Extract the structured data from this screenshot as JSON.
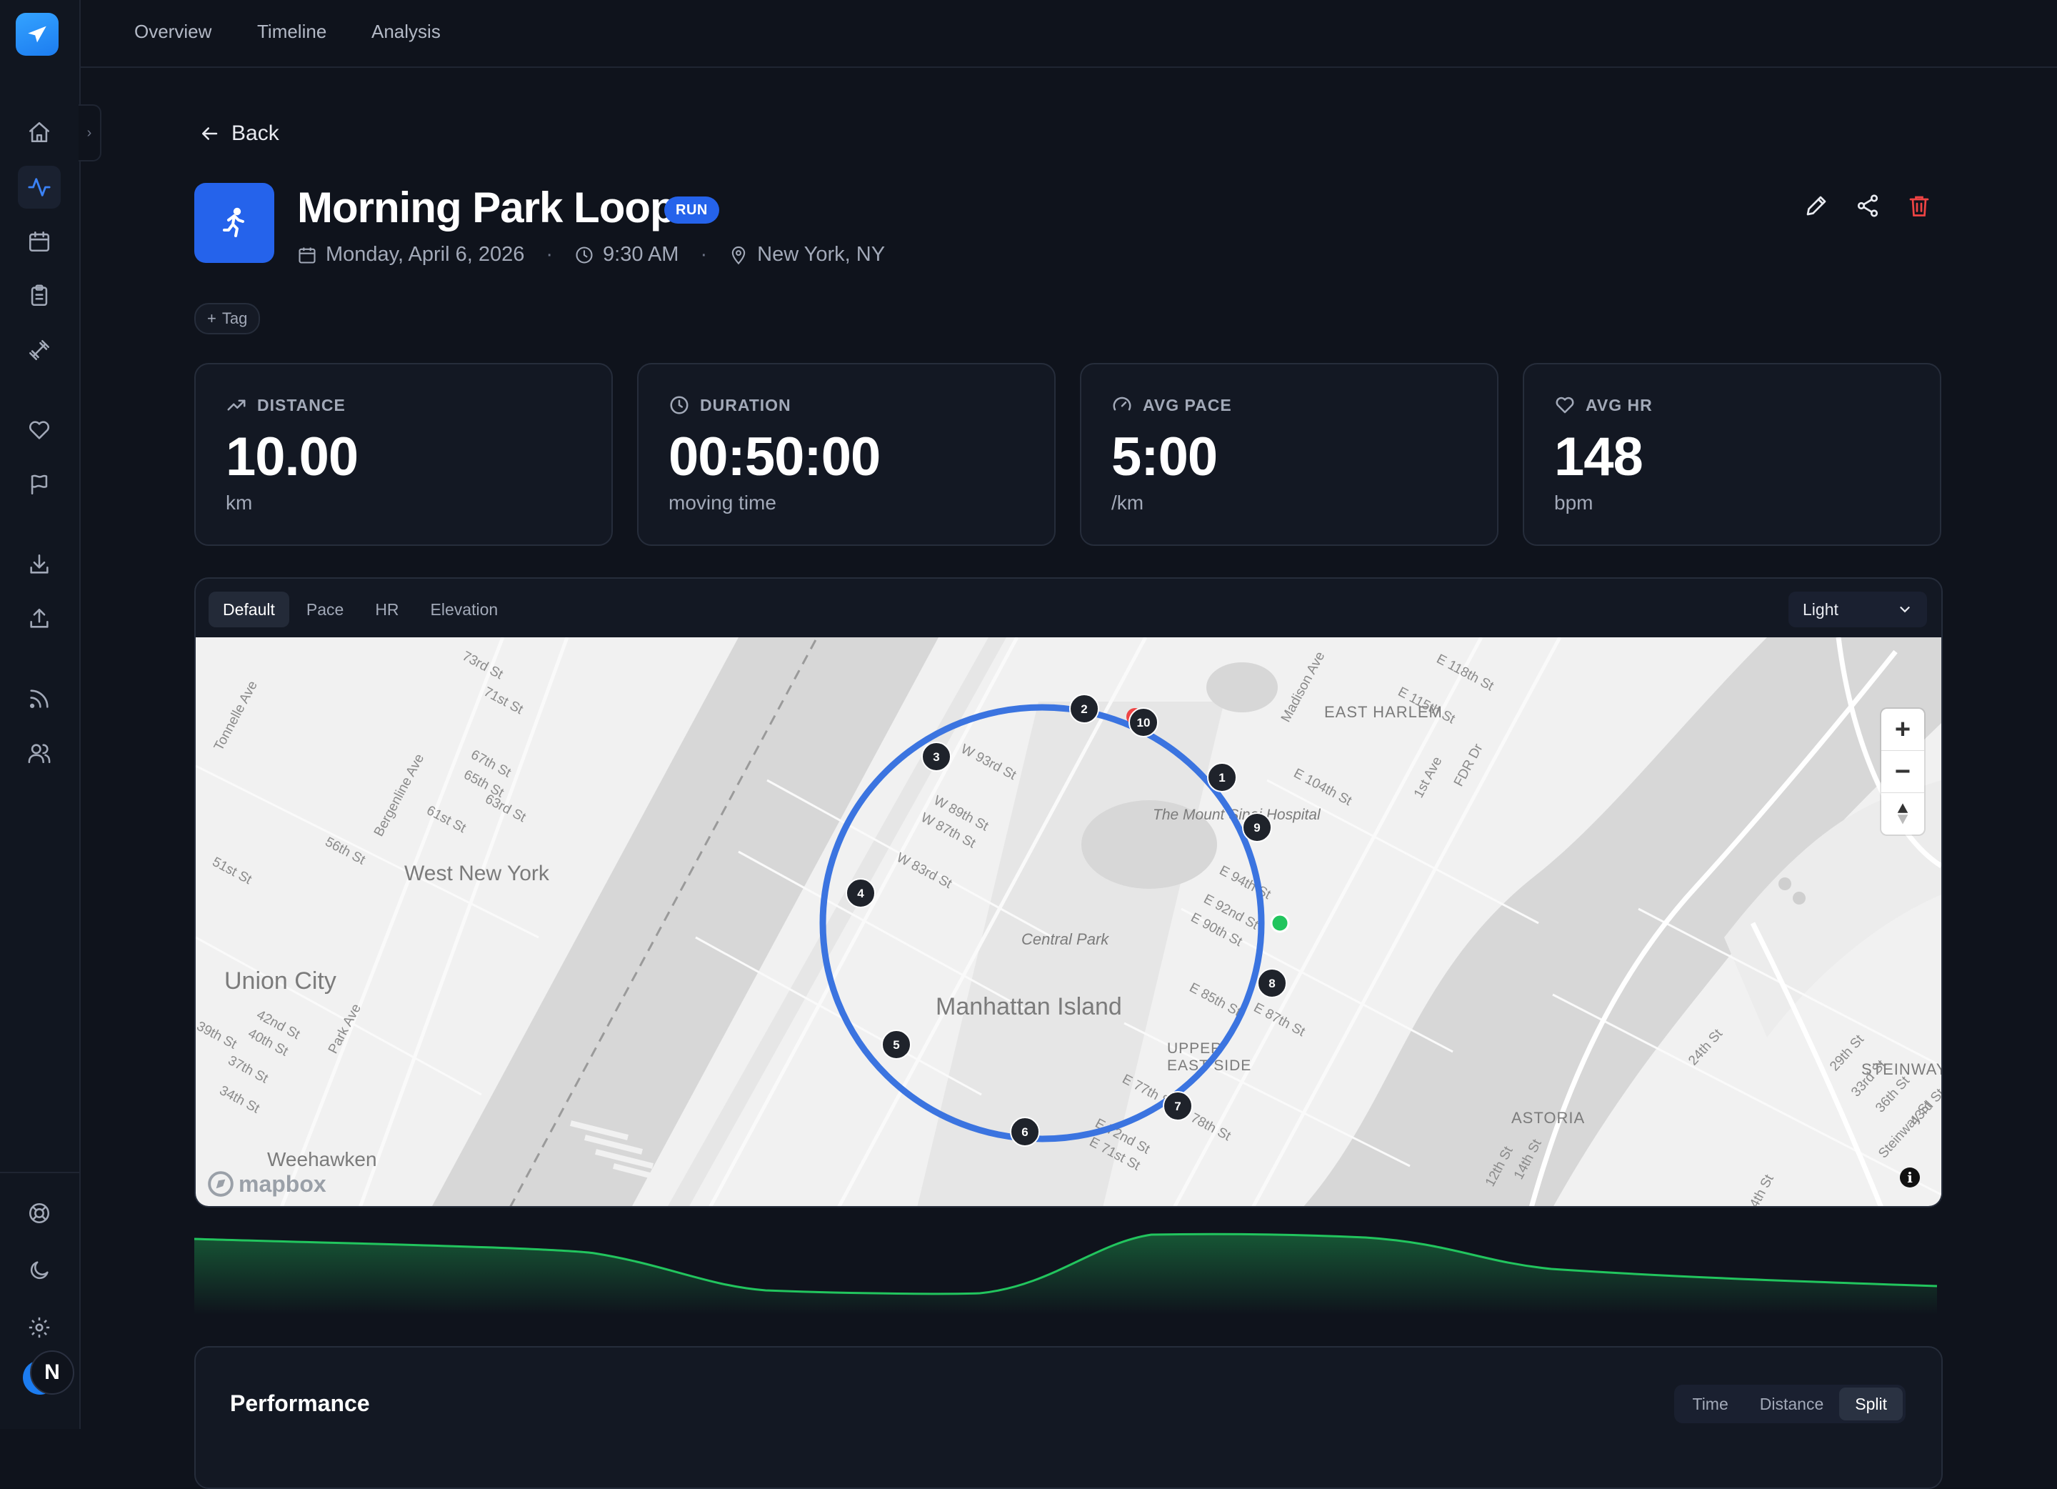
{
  "topnav": {
    "items": [
      "Overview",
      "Timeline",
      "Analysis"
    ]
  },
  "sidebar": {
    "icons": [
      "home-icon",
      "activity-icon",
      "calendar-icon",
      "clipboard-icon",
      "dumbbell-icon",
      "heart-icon",
      "flag-icon",
      "download-icon",
      "upload-icon",
      "rss-icon",
      "users-icon",
      "help-icon",
      "moon-icon",
      "gear-icon"
    ],
    "active": "activity-icon",
    "avatar_initial": "N"
  },
  "back_label": "Back",
  "activity": {
    "title": "Morning Park Loop",
    "type_badge": "RUN",
    "date": "Monday, April 6, 2026",
    "time": "9:30 AM",
    "location": "New York, NY",
    "tag_label": "Tag"
  },
  "stats": [
    {
      "label": "DISTANCE",
      "value": "10.00",
      "unit": "km",
      "icon": "trending-up-icon"
    },
    {
      "label": "DURATION",
      "value": "00:50:00",
      "unit": "moving time",
      "icon": "clock-icon"
    },
    {
      "label": "AVG PACE",
      "value": "5:00",
      "unit": "/km",
      "icon": "gauge-icon"
    },
    {
      "label": "AVG HR",
      "value": "148",
      "unit": "bpm",
      "icon": "heart-icon"
    }
  ],
  "map": {
    "tabs": [
      "Default",
      "Pace",
      "HR",
      "Elevation"
    ],
    "active_tab": "Default",
    "style": "Light",
    "attribution": "mapbox",
    "route_color": "#3b74e0",
    "start_color": "#22c55e",
    "end_color": "#ef4444",
    "km_markers": [
      "1",
      "2",
      "3",
      "4",
      "5",
      "6",
      "7",
      "8",
      "9",
      "10"
    ],
    "labels": {
      "manhattan": "Manhattan Island",
      "central_park": "Central Park",
      "west_new_york": "West New York",
      "union_city": "Union City",
      "weehawken": "Weehawken",
      "east_harlem": "EAST HARLEM",
      "upper_east_side_1": "UPPER",
      "upper_east_side_2": "EAST SIDE",
      "astoria": "ASTORIA",
      "steinway": "STEINWAY",
      "mount_sinai": "The Mount Sinai Hospital",
      "streets": [
        "W 93rd St",
        "W 89th St",
        "W 87th St",
        "W 83rd St",
        "E 94th St",
        "E 92nd St",
        "E 90th St",
        "E 85th St",
        "E 87th St",
        "E 77th St",
        "E 78th St",
        "E 72nd St",
        "E 71st St",
        "E 104th St",
        "E 115th St",
        "E 118th St",
        "Madison Ave",
        "1st Ave",
        "FDR Dr",
        "73rd St",
        "71st St",
        "67th St",
        "65th St",
        "63rd St",
        "61st St",
        "56th St",
        "51st St",
        "42nd St",
        "40th St",
        "39th St",
        "37th St",
        "34th St",
        "Tonnelle Ave",
        "Bergenline Ave",
        "Park Ave",
        "24th St",
        "29th St",
        "33rd St",
        "36th St",
        "43rd St",
        "Steinway St",
        "12th St",
        "14th St",
        "4th St"
      ]
    }
  },
  "elevation_color": "#22c55e",
  "performance": {
    "title": "Performance",
    "segments": [
      "Time",
      "Distance",
      "Split"
    ],
    "active": "Split"
  }
}
